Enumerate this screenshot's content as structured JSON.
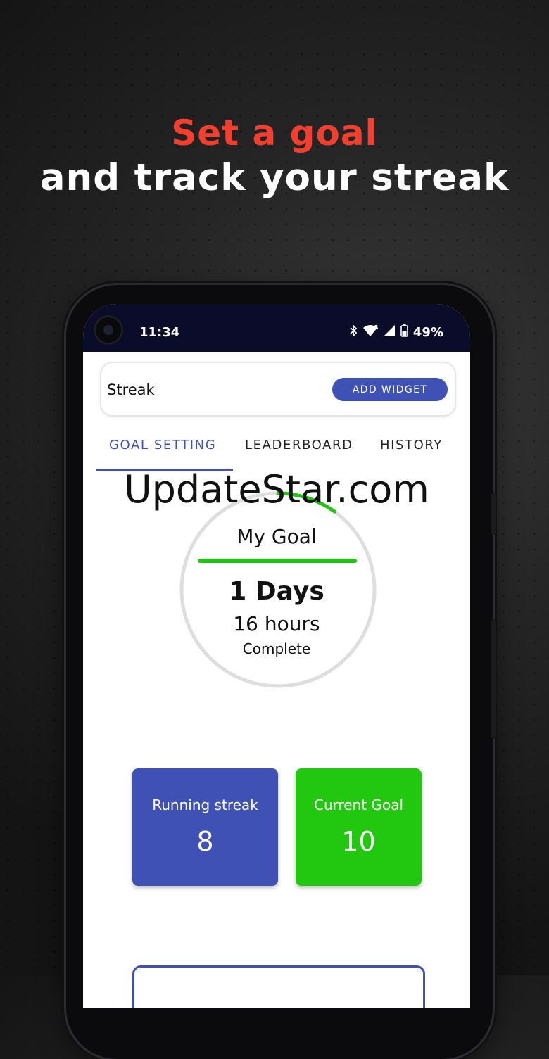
{
  "headline": {
    "line1": "Set a goal",
    "line2": "and track your streak"
  },
  "status_bar": {
    "time": "11:34",
    "battery": "49%",
    "icons": [
      "bluetooth-icon",
      "wifi-icon",
      "signal-icon",
      "battery-icon"
    ]
  },
  "app_bar": {
    "title": "Streak",
    "add_widget_label": "ADD WIDGET"
  },
  "tabs": [
    {
      "label": "GOAL SETTING",
      "active": true
    },
    {
      "label": "LEADERBOARD",
      "active": false
    },
    {
      "label": "HISTORY",
      "active": false
    }
  ],
  "watermark": "UpdateStar.com",
  "goal": {
    "title": "My Goal",
    "days": "1 Days",
    "hours": "16 hours",
    "status": "Complete",
    "progress_fraction": 0.1
  },
  "stats": {
    "running_streak": {
      "label": "Running streak",
      "value": "8"
    },
    "current_goal": {
      "label": "Current Goal",
      "value": "10"
    }
  },
  "colors": {
    "accent": "#3f51b5",
    "green": "#22c70f",
    "headline_red": "#f43f2e",
    "status_bar": "#0b0b2a"
  }
}
